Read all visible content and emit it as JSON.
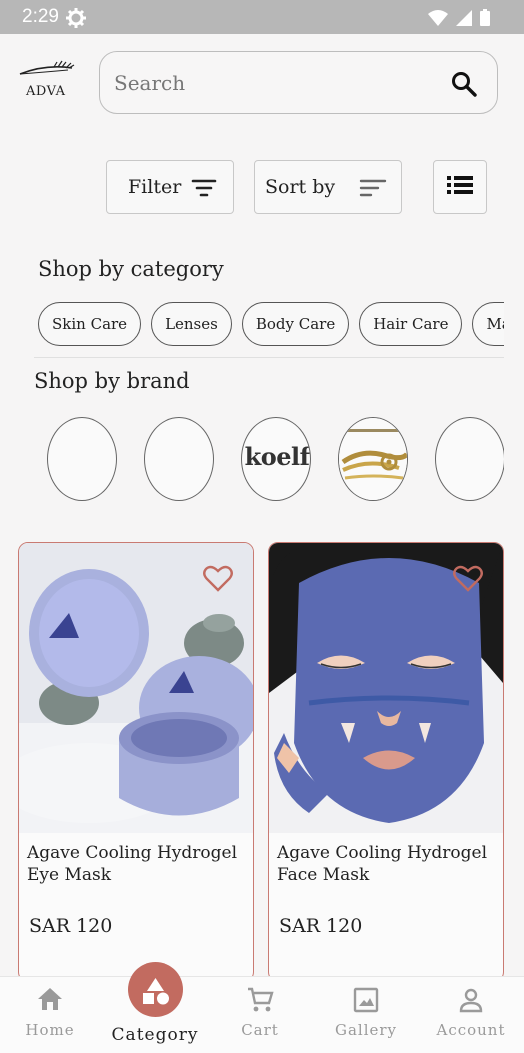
{
  "status_bar": {
    "time": "2:29",
    "icons": [
      "settings-icon",
      "wifi-icon",
      "signal-icon",
      "battery-icon"
    ]
  },
  "header": {
    "logo_text": "ADVA",
    "search": {
      "placeholder": "Search",
      "value": ""
    }
  },
  "toolbar": {
    "filter_label": "Filter",
    "sort_label": "Sort by"
  },
  "categories": {
    "title": "Shop by category",
    "items": [
      "Skin Care",
      "Lenses",
      "Body Care",
      "Hair Care",
      "Makeup"
    ]
  },
  "brands": {
    "title": "Shop by brand",
    "items": [
      {
        "name": ""
      },
      {
        "name": ""
      },
      {
        "name": "koelf"
      },
      {
        "name": ""
      },
      {
        "name": ""
      }
    ]
  },
  "products": [
    {
      "name": "Agave Cooling Hydrogel Eye Mask",
      "price": "SAR 120",
      "favorite": false
    },
    {
      "name": "Agave Cooling Hydrogel Face Mask",
      "price": "SAR 120",
      "favorite": false
    }
  ],
  "bottom_nav": [
    {
      "label": "Home",
      "icon": "home-icon",
      "active": false
    },
    {
      "label": "Category",
      "icon": "category-icon",
      "active": true
    },
    {
      "label": "Cart",
      "icon": "cart-icon",
      "active": false
    },
    {
      "label": "Gallery",
      "icon": "gallery-icon",
      "active": false
    },
    {
      "label": "Account",
      "icon": "account-icon",
      "active": false
    }
  ],
  "colors": {
    "accent": "#c26b60",
    "card_border": "#c97a72",
    "background": "#f6f5f5"
  }
}
